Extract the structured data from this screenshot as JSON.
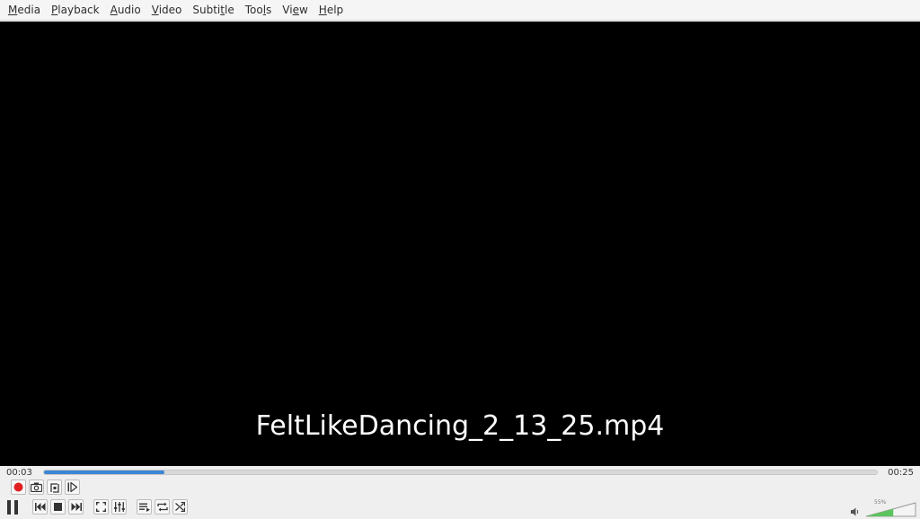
{
  "menu": [
    {
      "accel": "M",
      "rest": "edia"
    },
    {
      "accel": "P",
      "rest": "layback"
    },
    {
      "accel": "A",
      "rest": "udio"
    },
    {
      "accel": "V",
      "rest": "ideo"
    },
    {
      "pre": "Subti",
      "accel": "t",
      "rest": "le"
    },
    {
      "pre": "Too",
      "accel": "l",
      "rest": "s"
    },
    {
      "pre": "Vi",
      "accel": "e",
      "rest": "w"
    },
    {
      "accel": "H",
      "rest": "elp"
    }
  ],
  "video": {
    "osd_filename": "FeltLikeDancing_2_13_25.mp4"
  },
  "playback": {
    "elapsed": "00:03",
    "total": "00:25",
    "progress_fraction": 0.145
  },
  "volume": {
    "label": "55%",
    "level_fraction": 0.55
  },
  "icons": {
    "record": "record-icon",
    "snapshot": "camera-icon",
    "loop_ab": "loop-ab-icon",
    "frame_step": "frame-step-icon",
    "pause": "pause-icon",
    "previous": "previous-icon",
    "stop": "stop-icon",
    "next": "next-icon",
    "fullscreen": "fullscreen-icon",
    "extended": "equalizer-icon",
    "playlist": "playlist-icon",
    "repeat": "repeat-icon",
    "shuffle": "shuffle-icon",
    "speaker": "speaker-icon"
  },
  "colors": {
    "progress": "#3d86d6",
    "record": "#e02020",
    "volume_fill": "#5cc45c"
  }
}
